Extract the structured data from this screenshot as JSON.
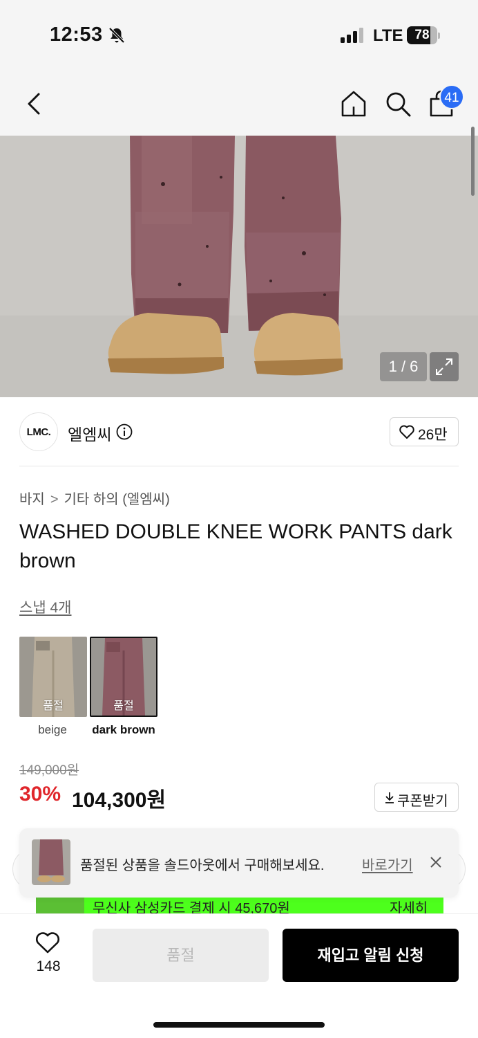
{
  "status_bar": {
    "time": "12:53",
    "network": "LTE",
    "battery": "78",
    "battery_level": 0.78
  },
  "nav": {
    "cart_badge": "41"
  },
  "hero": {
    "counter": "1 / 6"
  },
  "brand": {
    "logo_text": "LMC.",
    "name": "엘엠씨",
    "likes": "26만"
  },
  "breadcrumb": {
    "level1": "바지",
    "separator": ">",
    "level2": "기타 하의 (엘엠씨)"
  },
  "product": {
    "title": "WASHED DOUBLE KNEE WORK PANTS dark brown",
    "snap_link": "스냅 4개"
  },
  "color_options": [
    {
      "name": "beige",
      "badge": "품절",
      "color": "#b7ad9c"
    },
    {
      "name": "dark brown",
      "badge": "품절",
      "color": "#8c5a63"
    }
  ],
  "price": {
    "original": "149,000원",
    "discount": "30%",
    "sale": "104,300원",
    "coupon_label": "쿠폰받기"
  },
  "promo": {
    "text": "무신사 삼성카드 결제 시 45,670원",
    "detail": "자세히"
  },
  "toast": {
    "message": "품절된 상품을 솔드아웃에서 구매해보세요.",
    "link": "바로가기"
  },
  "bottom_bar": {
    "wish_count": "148",
    "soldout_label": "품절",
    "restock_label": "재입고 알림 신청"
  },
  "colors": {
    "discount_red": "#e0262b",
    "badge_blue": "#2a6cf5",
    "promo_green": "#4dff1c"
  }
}
